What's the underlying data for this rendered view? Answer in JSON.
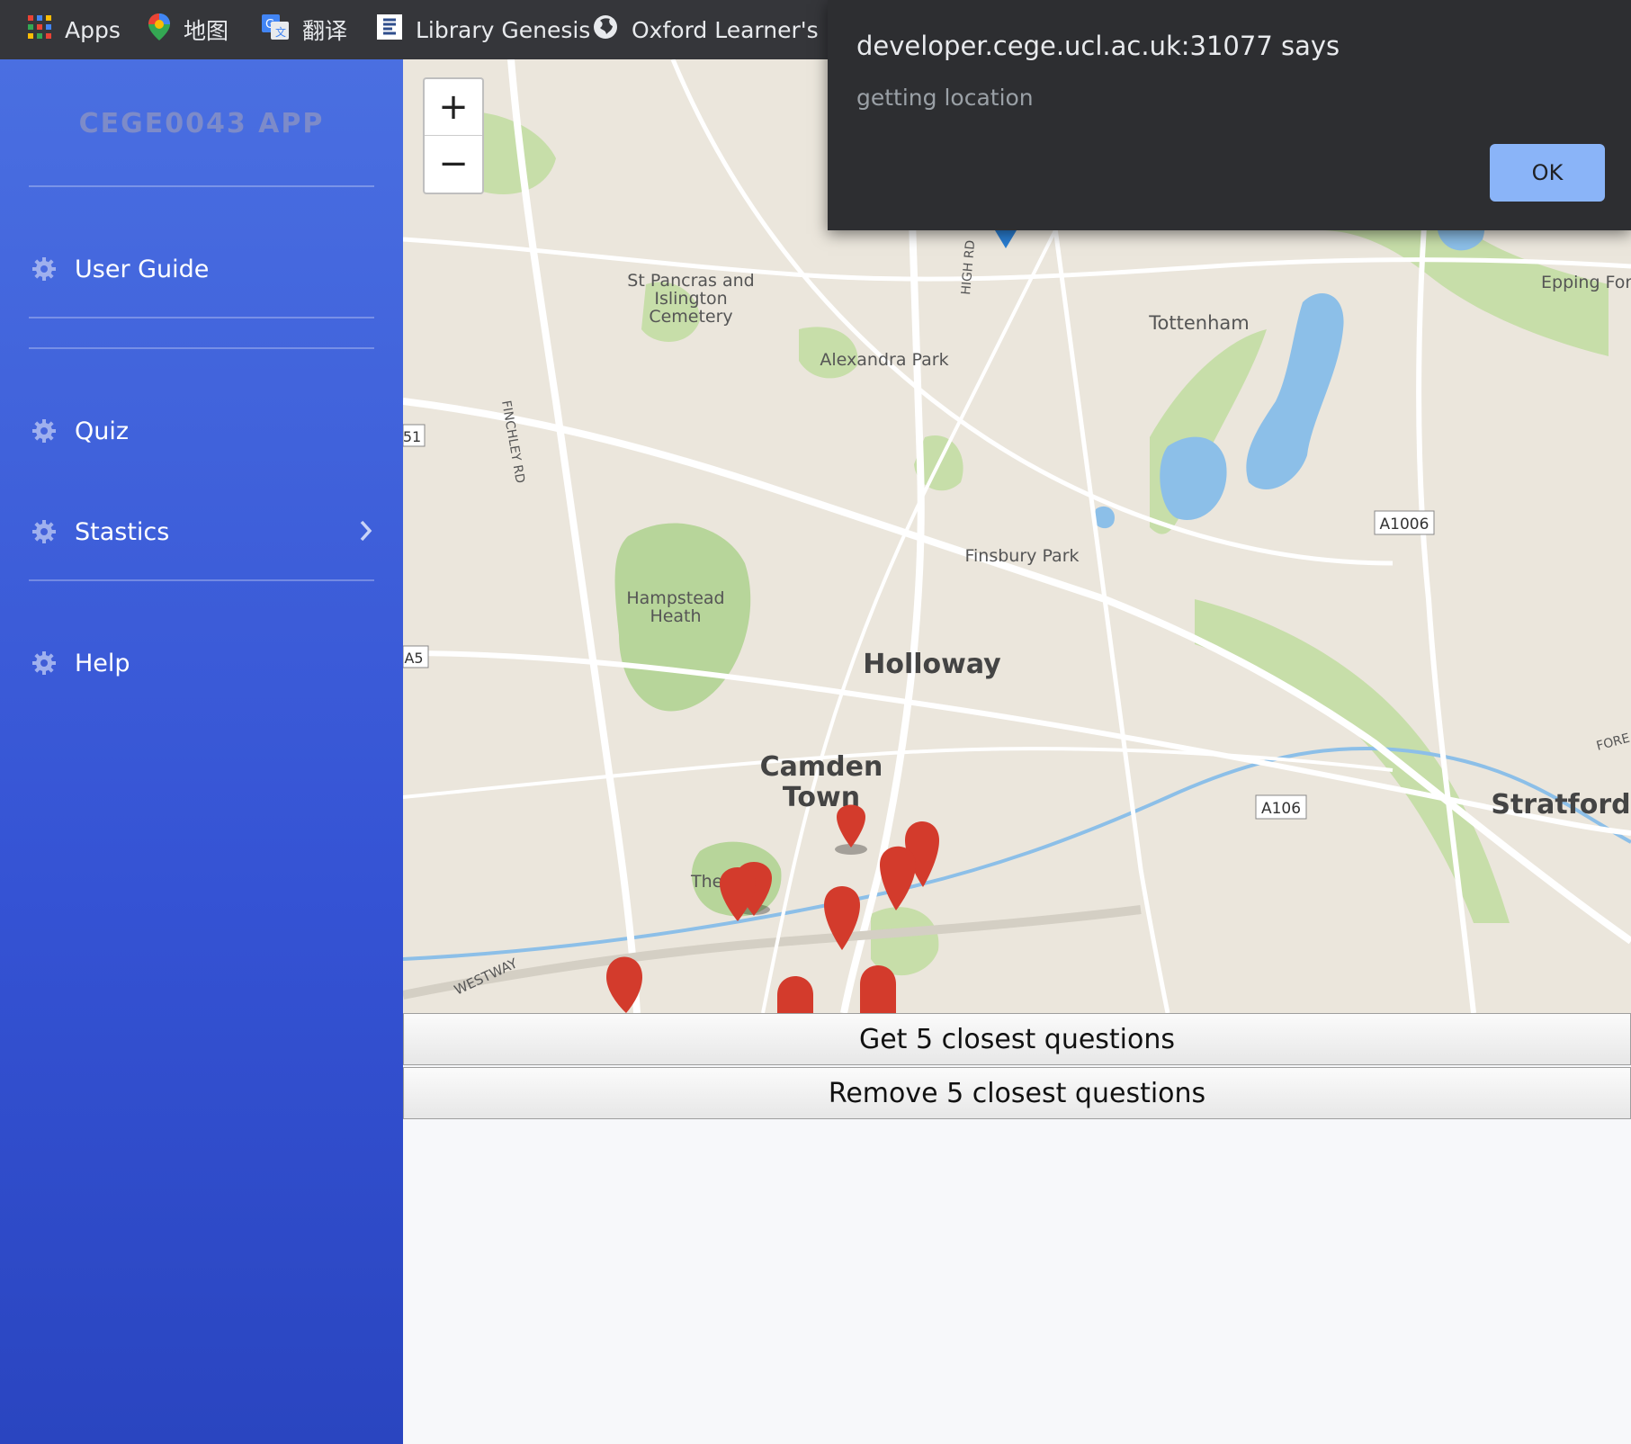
{
  "bookmarks": [
    {
      "label": "Apps",
      "icon": "apps-grid-icon"
    },
    {
      "label": "地图",
      "icon": "maps-pin-icon"
    },
    {
      "label": "翻译",
      "icon": "translate-icon"
    },
    {
      "label": "Library Genesis",
      "icon": "library-icon"
    },
    {
      "label": "Oxford Learner's Di...",
      "icon": "globe-icon"
    }
  ],
  "sidebar": {
    "brand": "CEGE0043 APP",
    "items": [
      {
        "label": "User Guide",
        "icon": "gear-icon"
      },
      {
        "label": "Quiz",
        "icon": "gear-icon"
      },
      {
        "label": "Stastics",
        "icon": "gear-icon",
        "has_submenu": true
      },
      {
        "label": "Help",
        "icon": "gear-icon"
      }
    ]
  },
  "map": {
    "zoom_in": "+",
    "zoom_out": "−",
    "places": {
      "st_pancras_1": "St Pancras and",
      "st_pancras_2": "Islington",
      "st_pancras_3": "Cemetery",
      "alexandra": "Alexandra Park",
      "tottenham": "Tottenham",
      "epping": "Epping For",
      "finsbury": "Finsbury Park",
      "hampstead_1": "Hampstead",
      "hampstead_2": "Heath",
      "holloway": "Holloway",
      "camden_1": "Camden",
      "camden_2": "Town",
      "stratford": "Stratford",
      "regents": "The    nt's",
      "a1006": "A1006",
      "a106": "A106",
      "a5": "A5",
      "a51": "51",
      "finchley": "FINCHLEY RD",
      "highrd": "HIGH RD",
      "westway": "WESTWAY",
      "fore": "FORE"
    },
    "marker_color": "#d33b2c"
  },
  "actions": {
    "get": "Get 5 closest questions",
    "remove": "Remove 5 closest questions"
  },
  "dialog": {
    "title": "developer.cege.ucl.ac.uk:31077 says",
    "message": "getting location",
    "ok": "OK"
  }
}
